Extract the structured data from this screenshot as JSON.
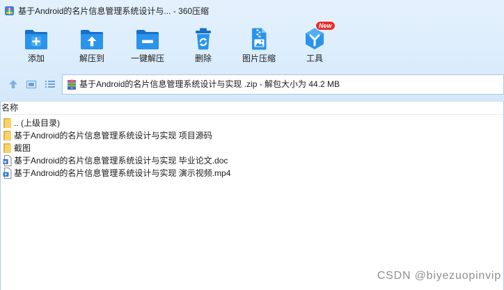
{
  "window": {
    "title": "基于Android的名片信息管理系统设计与... - 360压缩",
    "app_icon": "app-logo-icon"
  },
  "toolbar": {
    "buttons": [
      {
        "label": "添加",
        "icon": "add-folder-icon"
      },
      {
        "label": "解压到",
        "icon": "extract-to-folder-icon"
      },
      {
        "label": "一键解压",
        "icon": "one-click-extract-icon"
      },
      {
        "label": "删除",
        "icon": "trash-icon"
      },
      {
        "label": "图片压缩",
        "icon": "image-compress-icon"
      },
      {
        "label": "工具",
        "icon": "tools-icon",
        "badge": "New"
      }
    ]
  },
  "navigation": {
    "icons": [
      "up-arrow-icon",
      "thumbnail-view-icon",
      "list-view-icon"
    ]
  },
  "address": {
    "icon": "zip-archive-icon",
    "text": "基于Android的名片信息管理系统设计与实现 .zip - 解包大小为 44.2 MB"
  },
  "file_list": {
    "column_header": "名称",
    "items": [
      {
        "name": ".. (上级目录)",
        "icon": "folder-icon"
      },
      {
        "name": "基于Android的名片信息管理系统设计与实现 项目源码",
        "icon": "folder-icon"
      },
      {
        "name": "截图",
        "icon": "folder-icon"
      },
      {
        "name": "基于Android的名片信息管理系统设计与实现 毕业论文.doc",
        "icon": "word-document-icon"
      },
      {
        "name": "基于Android的名片信息管理系统设计与实现 演示视频.mp4",
        "icon": "video-file-icon"
      }
    ]
  },
  "watermark": "CSDN @biyezuopinvip",
  "colors": {
    "chrome_background": "#dcedfc",
    "toolbar_icon_blue": "#2a94ec",
    "badge_red": "#e5302d",
    "folder_yellow": "#f9d26a",
    "list_background": "#ffffff",
    "watermark_gray": "#8f8f8f"
  }
}
